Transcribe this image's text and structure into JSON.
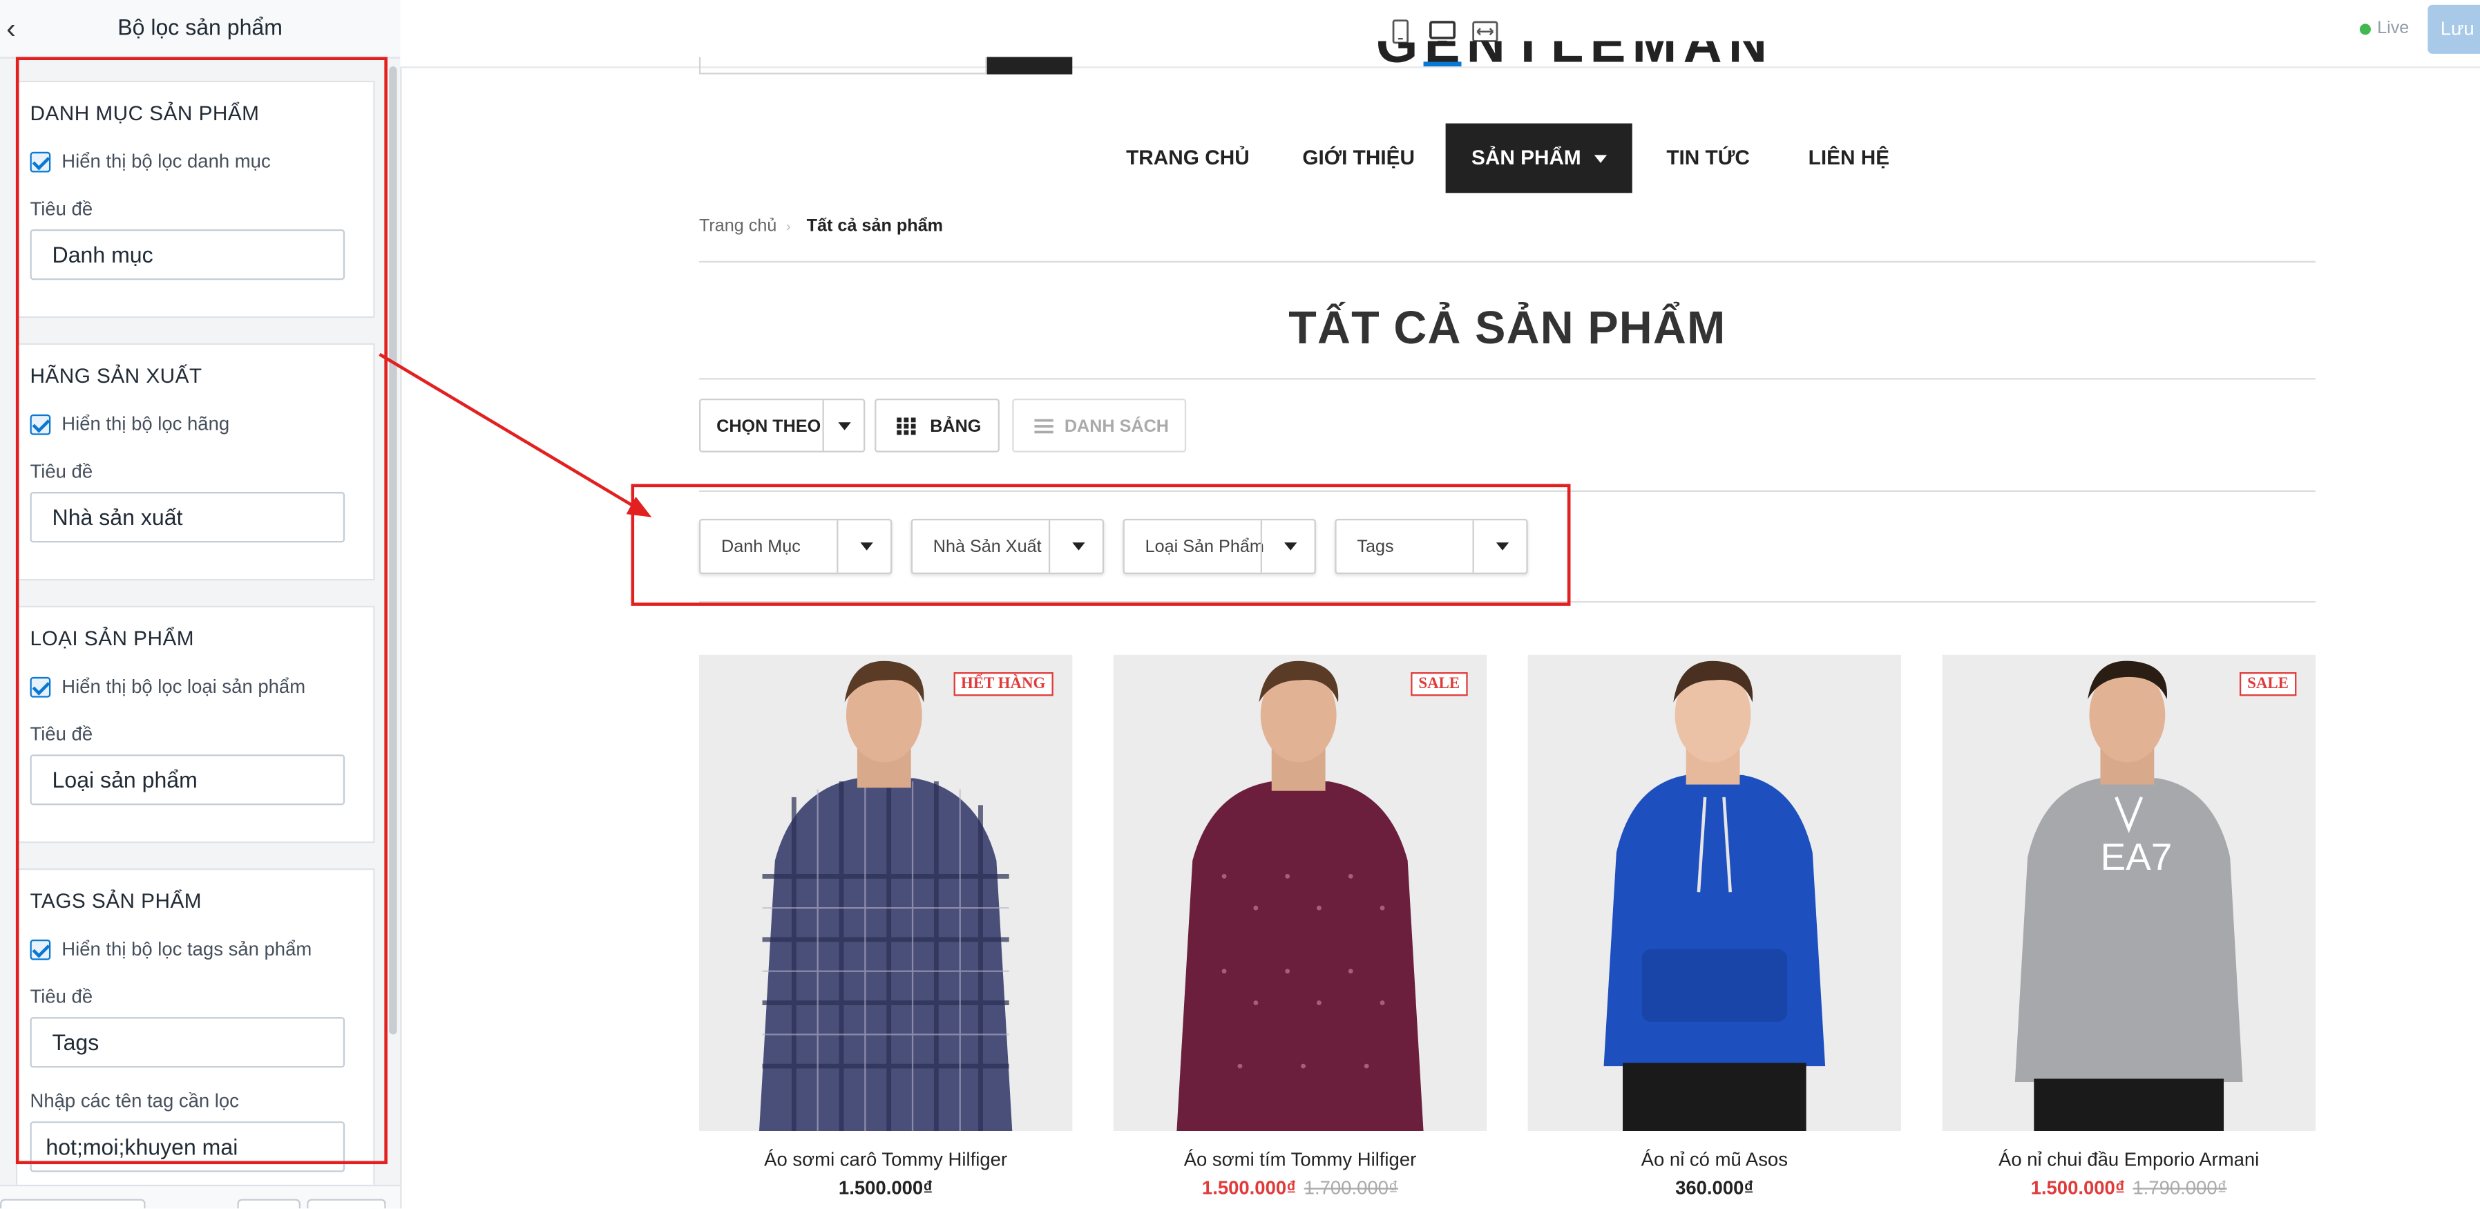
{
  "panel": {
    "title": "Bộ lọc sản phẩm",
    "sections": [
      {
        "title": "DANH MỤC SẢN PHẨM",
        "checkbox_label": "Hiển thị bộ lọc danh mục",
        "field_label": "Tiêu đề",
        "field_value": "Danh mục"
      },
      {
        "title": "HÃNG SẢN XUẤT",
        "checkbox_label": "Hiển thị bộ lọc hãng",
        "field_label": "Tiêu đề",
        "field_value": "Nhà sản xuất"
      },
      {
        "title": "LOẠI SẢN PHẨM",
        "checkbox_label": "Hiển thị bộ lọc loại sản phẩm",
        "field_label": "Tiêu đề",
        "field_value": "Loại sản phẩm"
      },
      {
        "title": "TAGS SẢN PHẨM",
        "checkbox_label": "Hiển thị bộ lọc tags sản phẩm",
        "field_label": "Tiêu đề",
        "field_value": "Tags",
        "extra_label": "Nhập các tên tag cần lọc",
        "extra_value": "hot;moi;khuyen mai"
      }
    ]
  },
  "toolbar": {
    "devices": [
      "mobile-icon",
      "desktop-icon",
      "fullwidth-icon"
    ],
    "active_device": "desktop",
    "live_label": "Live",
    "save_label": "Lưu"
  },
  "store": {
    "logo": "GENTLEMAN",
    "nav": [
      "TRANG CHỦ",
      "GIỚI THIỆU",
      "SẢN PHẨM",
      "TIN TỨC",
      "LIÊN HỆ"
    ],
    "active_nav": "SẢN PHẨM",
    "breadcrumb": {
      "home": "Trang chủ",
      "separator": "›",
      "current": "Tất cả sản phẩm"
    },
    "page_title": "TẤT CẢ SẢN PHẨM",
    "sort_label": "CHỌN THEO",
    "view_grid_label": "BẢNG",
    "view_list_label": "DANH SÁCH",
    "filters": [
      "Danh Mục",
      "Nhà Sản Xuất",
      "Loại Sản Phẩm",
      "Tags"
    ],
    "products": [
      {
        "name": "Áo sơmi carô Tommy Hilfiger",
        "price": "1.500.000₫",
        "old_price": "",
        "badge": "HẾT HÀNG",
        "on_sale": false
      },
      {
        "name": "Áo sơmi tím Tommy Hilfiger",
        "price": "1.500.000₫",
        "old_price": "1.700.000₫",
        "badge": "SALE",
        "on_sale": true
      },
      {
        "name": "Áo nỉ có mũ Asos",
        "price": "360.000₫",
        "old_price": "",
        "badge": "",
        "on_sale": false
      },
      {
        "name": "Áo nỉ chui đầu Emporio Armani",
        "price": "1.500.000₫",
        "old_price": "1.790.000₫",
        "badge": "SALE",
        "on_sale": true
      }
    ]
  },
  "colors": {
    "accent": "#0a78d1",
    "annotation": "#e32020",
    "sale": "#e03a3a",
    "nav_active_bg": "#222222"
  }
}
